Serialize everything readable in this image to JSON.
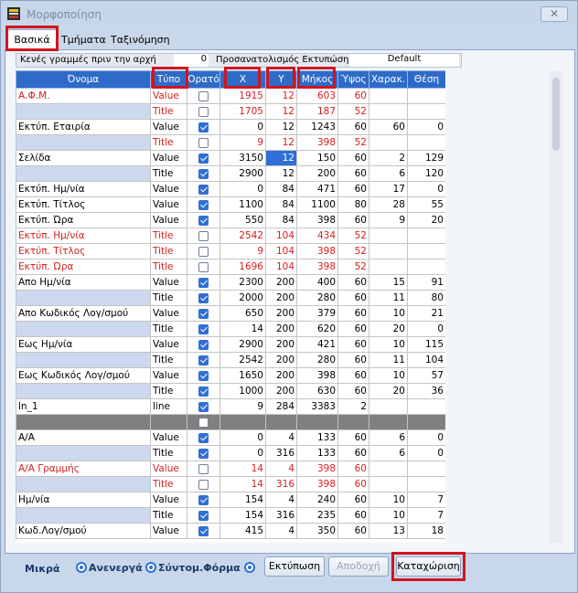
{
  "window": {
    "title": "Μορφοποίηση",
    "close_glyph": "✕"
  },
  "tabs": [
    {
      "label": "Βασικά"
    },
    {
      "label": "Τμήματα"
    },
    {
      "label": "Ταξινόμηση"
    }
  ],
  "options": {
    "blank_lines_label": "Κενές γραμμές πριν την αρχή",
    "blank_lines_value": "0",
    "orientation_label": "Προσανατολισμός Εκτυπώσης",
    "orientation_value": "Default"
  },
  "grid": {
    "headers": [
      "Όνομα",
      "Τύπο",
      "Ορατό",
      "X",
      "Y",
      "Μήκος",
      "Ύψος",
      "Χαρακ.",
      "Θέση"
    ],
    "rows": [
      {
        "name": "Α.Φ.Μ.",
        "type": "Value",
        "visible": false,
        "x": "1915",
        "y": "12",
        "len": "603",
        "h": "60",
        "chars": "",
        "pos": "",
        "kind": "red-main"
      },
      {
        "name": "",
        "type": "Title",
        "visible": false,
        "x": "1705",
        "y": "12",
        "len": "187",
        "h": "52",
        "chars": "",
        "pos": "",
        "kind": "red-sub"
      },
      {
        "name": "Εκτύπ. Εταιρία",
        "type": "Value",
        "visible": true,
        "x": "0",
        "y": "12",
        "len": "1243",
        "h": "60",
        "chars": "60",
        "pos": "0",
        "kind": "main"
      },
      {
        "name": "",
        "type": "Title",
        "visible": false,
        "x": "9",
        "y": "12",
        "len": "398",
        "h": "52",
        "chars": "",
        "pos": "",
        "kind": "red-sub"
      },
      {
        "name": "Σελίδα",
        "type": "Value",
        "visible": true,
        "x": "3150",
        "y": "12",
        "len": "150",
        "h": "60",
        "chars": "2",
        "pos": "129",
        "kind": "main",
        "selected": "y"
      },
      {
        "name": "",
        "type": "Title",
        "visible": true,
        "x": "2900",
        "y": "12",
        "len": "200",
        "h": "60",
        "chars": "6",
        "pos": "120",
        "kind": "sub"
      },
      {
        "name": "Εκτύπ. Ημ/νία",
        "type": "Value",
        "visible": true,
        "x": "0",
        "y": "84",
        "len": "471",
        "h": "60",
        "chars": "17",
        "pos": "0",
        "kind": "main"
      },
      {
        "name": "Εκτύπ. Τίτλος",
        "type": "Value",
        "visible": true,
        "x": "1100",
        "y": "84",
        "len": "1100",
        "h": "80",
        "chars": "28",
        "pos": "55",
        "kind": "main"
      },
      {
        "name": "Εκτύπ. Ώρα",
        "type": "Value",
        "visible": true,
        "x": "550",
        "y": "84",
        "len": "398",
        "h": "60",
        "chars": "9",
        "pos": "20",
        "kind": "main"
      },
      {
        "name": "Εκτύπ. Ημ/νία",
        "type": "Title",
        "visible": false,
        "x": "2542",
        "y": "104",
        "len": "434",
        "h": "52",
        "chars": "",
        "pos": "",
        "kind": "red-main"
      },
      {
        "name": "Εκτύπ. Τίτλος",
        "type": "Title",
        "visible": false,
        "x": "9",
        "y": "104",
        "len": "398",
        "h": "52",
        "chars": "",
        "pos": "",
        "kind": "red-main"
      },
      {
        "name": "Εκτύπ. Ώρα",
        "type": "Title",
        "visible": false,
        "x": "1696",
        "y": "104",
        "len": "398",
        "h": "52",
        "chars": "",
        "pos": "",
        "kind": "red-main"
      },
      {
        "name": "Απο Ημ/νία",
        "type": "Value",
        "visible": true,
        "x": "2300",
        "y": "200",
        "len": "400",
        "h": "60",
        "chars": "15",
        "pos": "91",
        "kind": "main"
      },
      {
        "name": "",
        "type": "Title",
        "visible": true,
        "x": "2000",
        "y": "200",
        "len": "280",
        "h": "60",
        "chars": "11",
        "pos": "80",
        "kind": "sub"
      },
      {
        "name": "Απο Κωδικός Λογ/σμού",
        "type": "Value",
        "visible": true,
        "x": "650",
        "y": "200",
        "len": "379",
        "h": "60",
        "chars": "10",
        "pos": "21",
        "kind": "main"
      },
      {
        "name": "",
        "type": "Title",
        "visible": true,
        "x": "14",
        "y": "200",
        "len": "620",
        "h": "60",
        "chars": "20",
        "pos": "0",
        "kind": "sub"
      },
      {
        "name": "Εως Ημ/νία",
        "type": "Value",
        "visible": true,
        "x": "2900",
        "y": "200",
        "len": "421",
        "h": "60",
        "chars": "10",
        "pos": "115",
        "kind": "main"
      },
      {
        "name": "",
        "type": "Title",
        "visible": true,
        "x": "2542",
        "y": "200",
        "len": "280",
        "h": "60",
        "chars": "11",
        "pos": "104",
        "kind": "sub"
      },
      {
        "name": "Εως Κωδικός Λογ/σμού",
        "type": "Value",
        "visible": true,
        "x": "1650",
        "y": "200",
        "len": "398",
        "h": "60",
        "chars": "10",
        "pos": "57",
        "kind": "main"
      },
      {
        "name": "",
        "type": "Title",
        "visible": true,
        "x": "1000",
        "y": "200",
        "len": "630",
        "h": "60",
        "chars": "20",
        "pos": "36",
        "kind": "sub"
      },
      {
        "name": "ln_1",
        "type": "line",
        "visible": true,
        "x": "9",
        "y": "284",
        "len": "3383",
        "h": "2",
        "chars": "",
        "pos": "",
        "kind": "main"
      },
      {
        "name": "",
        "type": "",
        "visible": false,
        "x": "",
        "y": "",
        "len": "",
        "h": "",
        "chars": "",
        "pos": "",
        "kind": "sep"
      },
      {
        "name": "Α/Α",
        "type": "Value",
        "visible": true,
        "x": "0",
        "y": "4",
        "len": "133",
        "h": "60",
        "chars": "6",
        "pos": "0",
        "kind": "main"
      },
      {
        "name": "",
        "type": "Title",
        "visible": true,
        "x": "0",
        "y": "316",
        "len": "133",
        "h": "60",
        "chars": "6",
        "pos": "0",
        "kind": "sub"
      },
      {
        "name": "Α/Α Γραμμής",
        "type": "Value",
        "visible": false,
        "x": "14",
        "y": "4",
        "len": "398",
        "h": "60",
        "chars": "",
        "pos": "",
        "kind": "red-main"
      },
      {
        "name": "",
        "type": "Title",
        "visible": false,
        "x": "14",
        "y": "316",
        "len": "398",
        "h": "60",
        "chars": "",
        "pos": "",
        "kind": "red-sub"
      },
      {
        "name": "Ημ/νία",
        "type": "Value",
        "visible": true,
        "x": "154",
        "y": "4",
        "len": "240",
        "h": "60",
        "chars": "10",
        "pos": "7",
        "kind": "main"
      },
      {
        "name": "",
        "type": "Title",
        "visible": true,
        "x": "154",
        "y": "316",
        "len": "235",
        "h": "60",
        "chars": "10",
        "pos": "7",
        "kind": "sub"
      },
      {
        "name": "Κωδ.Λογ/σμού",
        "type": "Value",
        "visible": true,
        "x": "415",
        "y": "4",
        "len": "350",
        "h": "60",
        "chars": "13",
        "pos": "18",
        "kind": "main"
      }
    ]
  },
  "footer": {
    "small_label": "Μικρά",
    "radio1_label": "Ανενεργά",
    "radio2_label": "Σύντομ.Φόρμα",
    "print_label": "Εκτύπωση",
    "cancel_label": "Αποδοχή",
    "save_label": "Καταχώριση"
  }
}
